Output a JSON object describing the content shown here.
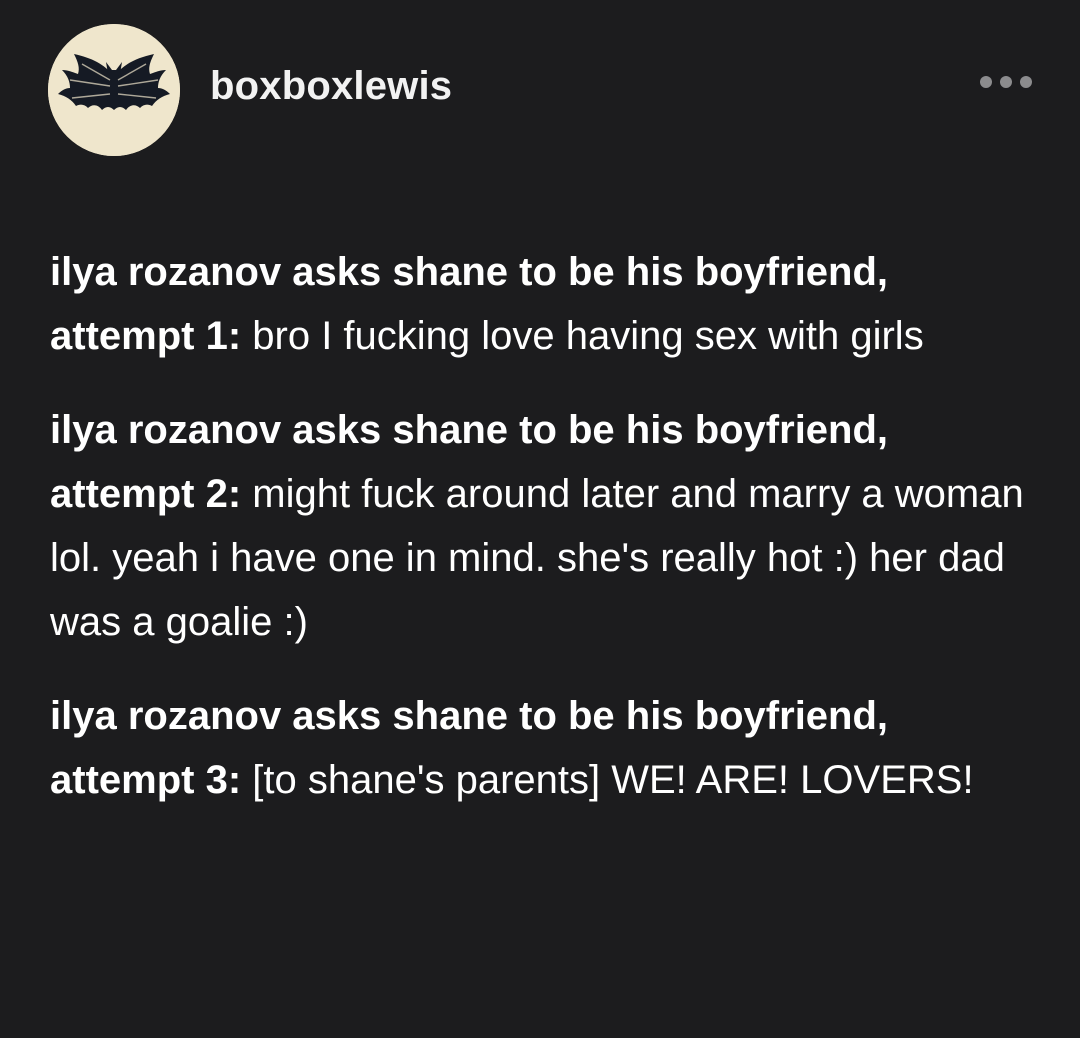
{
  "post": {
    "username": "boxboxlewis",
    "avatar_icon": "bat-icon",
    "more_icon": "more-options-icon",
    "paragraphs": [
      {
        "lead": "ilya rozanov asks shane to be his boyfriend, attempt 1:",
        "text": "bro I fucking love having sex with girls"
      },
      {
        "lead": "ilya rozanov asks shane to be his boyfriend, attempt 2:",
        "text": "might fuck around later and marry a woman lol. yeah i have one in mind. she's really hot :) her dad was a goalie :)"
      },
      {
        "lead": "ilya rozanov asks shane to be his boyfriend, attempt 3:",
        "text": "[to shane's parents] WE! ARE! LOVERS!"
      }
    ]
  },
  "colors": {
    "background": "#1c1c1e",
    "text": "#ffffff",
    "avatar_bg": "#efe6cc",
    "more_dots": "#8c8c8e"
  }
}
